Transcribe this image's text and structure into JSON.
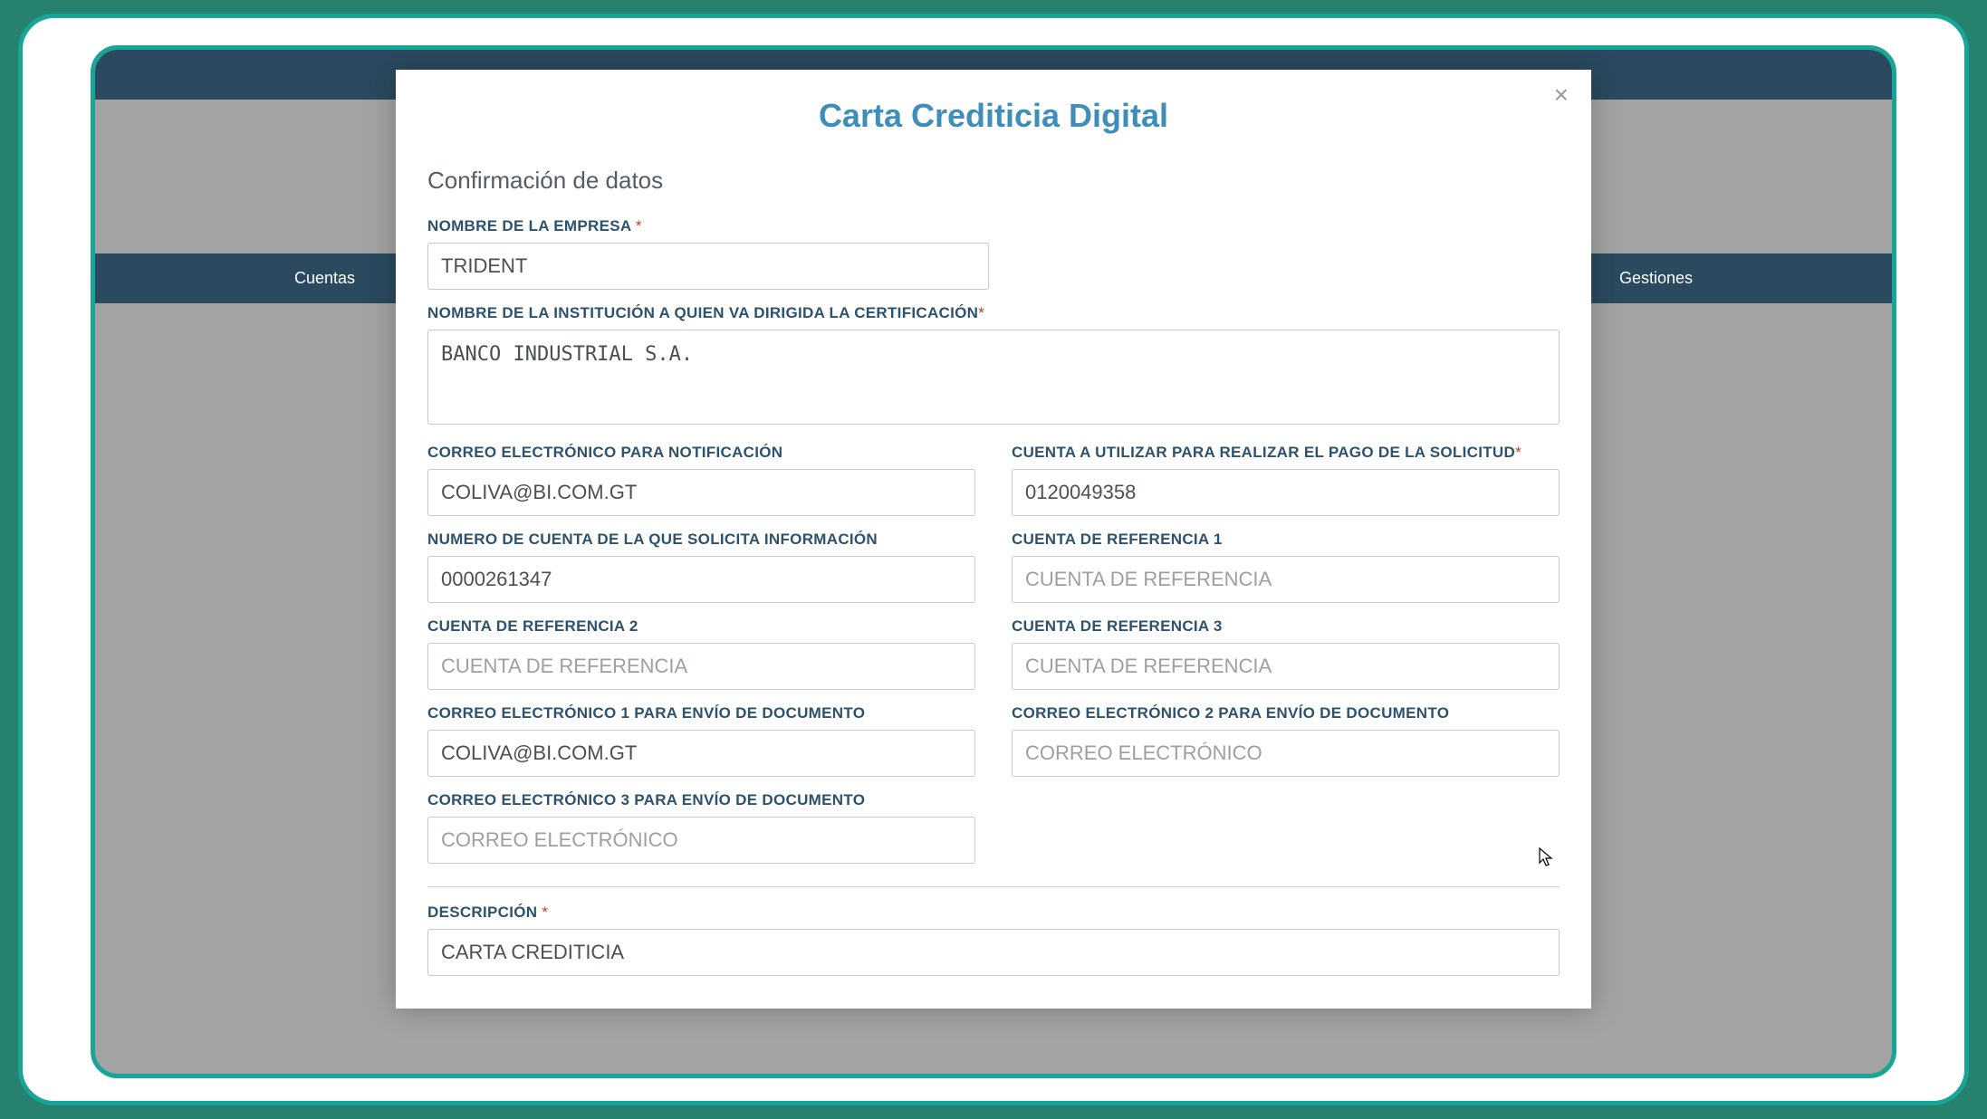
{
  "nav": {
    "left": "Cuentas",
    "right": "Gestiones"
  },
  "modal": {
    "title": "Carta Crediticia Digital",
    "subtitle": "Confirmación de datos",
    "close_label": "×",
    "fields": {
      "empresa_label": "NOMBRE DE LA EMPRESA ",
      "empresa_value": "TRIDENT",
      "institucion_label": "NOMBRE DE LA INSTITUCIÓN A QUIEN VA DIRIGIDA LA CERTIFICACIÓN",
      "institucion_value": "BANCO INDUSTRIAL S.A.",
      "correo_notif_label": "CORREO ELECTRÓNICO PARA NOTIFICACIÓN",
      "correo_notif_value": "COLIVA@BI.COM.GT",
      "cuenta_pago_label": "CUENTA A UTILIZAR PARA REALIZAR EL PAGO DE LA SOLICITUD",
      "cuenta_pago_value": "0120049358",
      "num_cuenta_info_label": "NUMERO DE CUENTA DE LA QUE SOLICITA INFORMACIÓN",
      "num_cuenta_info_value": "0000261347",
      "ref1_label": "CUENTA DE REFERENCIA 1",
      "ref1_placeholder": "CUENTA DE REFERENCIA",
      "ref2_label": "CUENTA DE REFERENCIA 2",
      "ref2_placeholder": "CUENTA DE REFERENCIA",
      "ref3_label": "CUENTA DE REFERENCIA 3",
      "ref3_placeholder": "CUENTA DE REFERENCIA",
      "correo_doc1_label": "CORREO ELECTRÓNICO 1 PARA ENVÍO DE DOCUMENTO",
      "correo_doc1_value": "COLIVA@BI.COM.GT",
      "correo_doc2_label": "CORREO ELECTRÓNICO 2 PARA ENVÍO DE DOCUMENTO",
      "correo_doc2_placeholder": "CORREO ELECTRÓNICO",
      "correo_doc3_label": "CORREO ELECTRÓNICO 3 PARA ENVÍO DE DOCUMENTO",
      "correo_doc3_placeholder": "CORREO ELECTRÓNICO",
      "descripcion_label": "DESCRIPCIÓN ",
      "descripcion_value": "CARTA CREDITICIA",
      "required_mark": "*"
    }
  }
}
